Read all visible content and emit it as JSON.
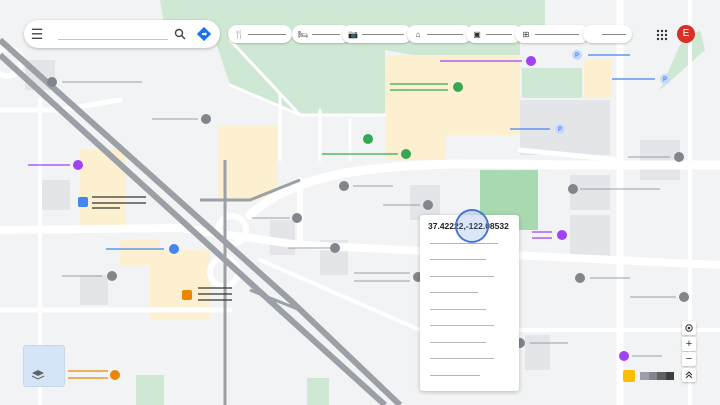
{
  "search": {
    "placeholder": "",
    "menu_icon": "hamburger-menu-icon",
    "search_icon": "magnifier-icon",
    "directions_icon": "directions-icon"
  },
  "chips": [
    {
      "icon": "restaurant-icon",
      "glyph": "🍴"
    },
    {
      "icon": "hotel-icon",
      "glyph": "🛏"
    },
    {
      "icon": "camera-icon",
      "glyph": "📷"
    },
    {
      "icon": "museum-icon",
      "glyph": "⌂"
    },
    {
      "icon": "transit-icon",
      "glyph": "▣"
    },
    {
      "icon": "pharmacy-icon",
      "glyph": "⊞"
    },
    {
      "icon": "more-icon",
      "glyph": ""
    }
  ],
  "account": {
    "initial": "E",
    "color": "#d93025"
  },
  "coordinate_card": {
    "coordinates": "37.42222,-122.08532"
  },
  "controls": {
    "zoom_in": "+",
    "zoom_out": "−",
    "locate_icon": "my-location-icon",
    "pegman_icon": "expand-icon"
  },
  "colors": {
    "park": "#cfe8d3",
    "park_dark": "#a8d9b0",
    "building": "#fdf0d1",
    "road": "#ffffff",
    "highway": "#9aa0a6",
    "background": "#f1f3f4",
    "accent_blue": "#4a78d0",
    "poi_gray": "#80868b",
    "poi_green": "#34a853",
    "poi_purple": "#a142f4",
    "poi_blue": "#4285f4",
    "poi_orange": "#ea8600"
  },
  "pois": [
    {
      "icon": "place-gray-icon"
    },
    {
      "icon": "place-gray-icon"
    },
    {
      "icon": "place-gray-icon"
    },
    {
      "icon": "park-green-icon"
    },
    {
      "icon": "park-green-icon"
    },
    {
      "icon": "park-green-icon"
    },
    {
      "icon": "parking-icon",
      "glyph": "P"
    },
    {
      "icon": "parking-icon",
      "glyph": "P"
    },
    {
      "icon": "parking-icon",
      "glyph": "P"
    },
    {
      "icon": "shopping-icon"
    },
    {
      "icon": "bank-icon"
    },
    {
      "icon": "restaurant-icon"
    }
  ]
}
